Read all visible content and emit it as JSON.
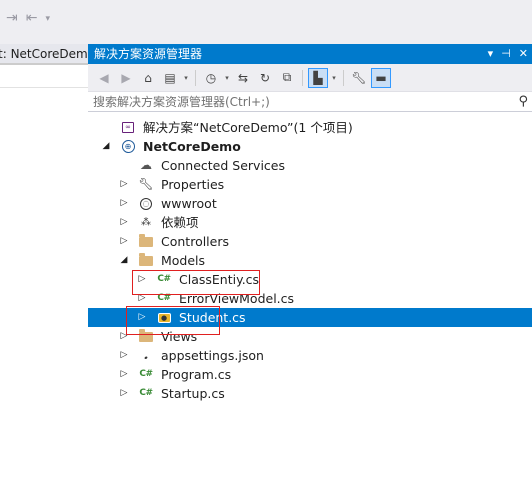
{
  "top_area": {
    "icons": [
      "indent-icon",
      "outdent-icon",
      "dropdown-arrow-icon"
    ]
  },
  "left_panel": {
    "tab_label": "t: NetCoreDemo"
  },
  "solution_explorer": {
    "title": "解决方案资源管理器",
    "title_controls": [
      "pin-dropdown-icon",
      "pin-icon",
      "close-icon"
    ],
    "search_placeholder": "搜索解决方案资源管理器(Ctrl+;)",
    "tree": [
      {
        "label": "解决方案“NetCoreDemo”(1 个项目)",
        "icon": "solution-icon",
        "expander": "none",
        "indent": 0
      },
      {
        "label": "NetCoreDemo",
        "icon": "web-project-icon",
        "expander": "expanded",
        "indent": 0,
        "bold": true
      },
      {
        "label": "Connected Services",
        "icon": "cloud-icon",
        "expander": "none",
        "indent": 1
      },
      {
        "label": "Properties",
        "icon": "wrench-icon",
        "expander": "collapsed",
        "indent": 1
      },
      {
        "label": "wwwroot",
        "icon": "globe-icon",
        "expander": "collapsed",
        "indent": 1
      },
      {
        "label": "依赖项",
        "icon": "dependencies-icon",
        "expander": "collapsed",
        "indent": 1
      },
      {
        "label": "Controllers",
        "icon": "folder-icon",
        "expander": "collapsed",
        "indent": 1
      },
      {
        "label": "Models",
        "icon": "folder-icon",
        "expander": "expanded",
        "indent": 1
      },
      {
        "label": "ClassEntiy.cs",
        "icon": "csharp-file-icon",
        "expander": "collapsed",
        "indent": 2
      },
      {
        "label": "ErrorViewModel.cs",
        "icon": "csharp-file-icon",
        "expander": "collapsed",
        "indent": 2
      },
      {
        "label": "Student.cs",
        "icon": "csharp-class-icon",
        "expander": "collapsed",
        "indent": 2,
        "selected": true
      },
      {
        "label": "Views",
        "icon": "folder-icon",
        "expander": "collapsed",
        "indent": 1
      },
      {
        "label": "appsettings.json",
        "icon": "json-file-icon",
        "expander": "collapsed",
        "indent": 1
      },
      {
        "label": "Program.cs",
        "icon": "csharp-file-icon",
        "expander": "collapsed",
        "indent": 1
      },
      {
        "label": "Startup.cs",
        "icon": "csharp-file-icon",
        "expander": "collapsed",
        "indent": 1
      }
    ]
  },
  "colors": {
    "accent": "#007acc",
    "highlight_box": "#e02020",
    "folder": "#dcb67a",
    "csharp": "#388a34"
  }
}
